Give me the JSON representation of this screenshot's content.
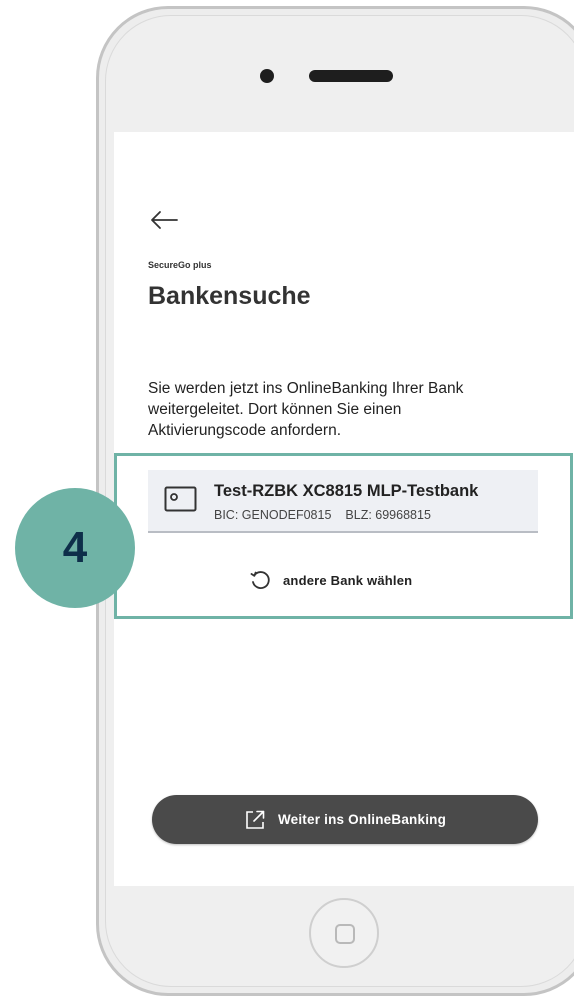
{
  "screen": {
    "back_icon": "arrow-left-icon",
    "app_label": "SecureGo plus",
    "title": "Bankensuche",
    "info_text": "Sie werden jetzt ins OnlineBanking Ihrer Bank weitergeleitet. Dort können Sie einen Aktivierungscode anfordern."
  },
  "bank": {
    "icon": "bank-card-icon",
    "name": "Test-RZBK XC8815 MLP-Testbank",
    "bic": "BIC: GENODEF0815",
    "blz": "BLZ: 69968815"
  },
  "other_bank": {
    "icon": "refresh-icon",
    "label": "andere Bank wählen"
  },
  "continue_button": {
    "icon": "external-link-icon",
    "label": "Weiter ins OnlineBanking"
  },
  "annotation": {
    "step_number": "4",
    "color": "#6fb3a6"
  },
  "colors": {
    "button_bg": "#4a4a4a",
    "card_bg": "#eef0f4",
    "badge_text": "#0e2f4a"
  }
}
